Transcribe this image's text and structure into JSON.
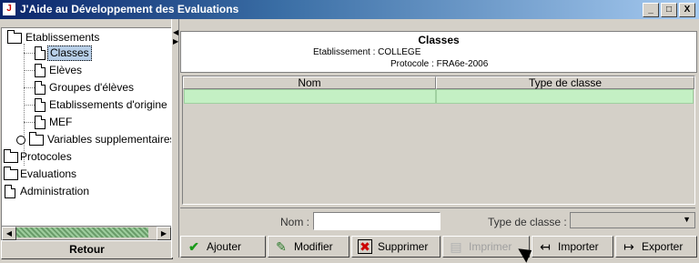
{
  "window": {
    "title": "J'Aide au Développement des Evaluations",
    "app_icon": "J",
    "btn_min": "_",
    "btn_max": "□",
    "btn_close": "X"
  },
  "tree": {
    "items": [
      {
        "label": "Etablissements",
        "icon": "folder-icon"
      },
      {
        "label": "Classes",
        "icon": "document-icon",
        "selected": true
      },
      {
        "label": "Elèves",
        "icon": "document-icon"
      },
      {
        "label": "Groupes d'élèves",
        "icon": "document-icon"
      },
      {
        "label": "Etablissements d'origine",
        "icon": "document-icon"
      },
      {
        "label": "MEF",
        "icon": "document-icon"
      },
      {
        "label": "Variables supplementaires",
        "icon": "folder-icon"
      },
      {
        "label": "Protocoles",
        "icon": "folder-icon"
      },
      {
        "label": "Evaluations",
        "icon": "folder-icon"
      },
      {
        "label": "Administration",
        "icon": "document-icon"
      }
    ]
  },
  "retour_label": "Retour",
  "header": {
    "title": "Classes",
    "etablissement": "Etablissement : COLLEGE",
    "protocole": "Protocole : FRA6e-2006"
  },
  "table": {
    "columns": [
      "Nom",
      "Type de classe"
    ],
    "row_color": "#c4f0c4"
  },
  "filter": {
    "nom_label": "Nom :",
    "nom_value": "",
    "type_label": "Type de classe :",
    "type_value": ""
  },
  "buttons": {
    "ajouter": "Ajouter",
    "modifier": "Modifier",
    "supprimer": "Supprimer",
    "imprimer": "Imprimer",
    "importer": "Importer",
    "exporter": "Exporter"
  }
}
